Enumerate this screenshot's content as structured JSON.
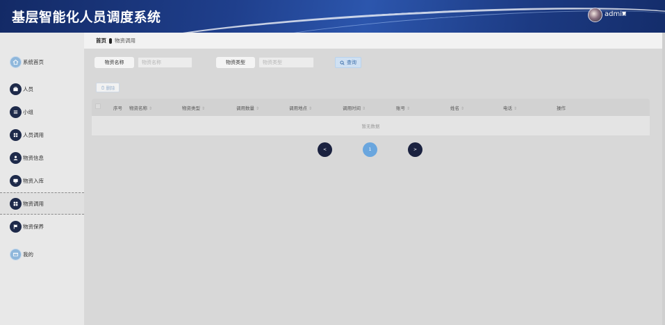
{
  "header": {
    "title": "基层智能化人员调度系统",
    "username": "admin",
    "caret": "▼"
  },
  "sidebar": {
    "items": [
      {
        "label": "系统首页",
        "icon": "home-icon",
        "style": "light"
      },
      {
        "label": "人员",
        "icon": "briefcase-icon",
        "style": "dark"
      },
      {
        "label": "小组",
        "icon": "menu-icon",
        "style": "dark"
      },
      {
        "label": "人员调用",
        "icon": "grid-icon",
        "style": "dark"
      },
      {
        "label": "物资信息",
        "icon": "user-icon",
        "style": "dark"
      },
      {
        "label": "物资入库",
        "icon": "monitor-icon",
        "style": "dark"
      },
      {
        "label": "物资调用",
        "icon": "apps-icon",
        "style": "dark",
        "active": true
      },
      {
        "label": "物资保养",
        "icon": "flag-icon",
        "style": "dark"
      },
      {
        "label": "我的",
        "icon": "card-icon",
        "style": "light"
      }
    ]
  },
  "breadcrumb": {
    "home": "首页",
    "current": "物资调用"
  },
  "search": {
    "name_label": "物资名称",
    "name_placeholder": "物资名称",
    "type_label": "物资类型",
    "type_placeholder": "物资类型",
    "query_label": "查询"
  },
  "toolbar": {
    "delete_label": "删除"
  },
  "table": {
    "columns": [
      "序号",
      "物资名称",
      "物资类型",
      "调用数量",
      "调用地点",
      "调用时间",
      "账号",
      "姓名",
      "电话",
      "操作"
    ],
    "empty_text": "暂无数据"
  },
  "pagination": {
    "prev": "<",
    "page": "1",
    "next": ">"
  },
  "colors": {
    "header_bg": "#1f3f8c",
    "nav_icon_dark": "#1e2a4a",
    "page_active": "#6aa6de"
  }
}
